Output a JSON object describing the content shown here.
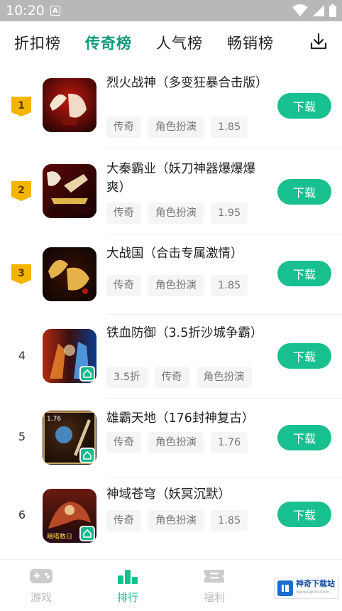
{
  "status_bar": {
    "time": "10:20",
    "a_icon": "A"
  },
  "tabs": [
    {
      "label": "折扣榜",
      "active": false
    },
    {
      "label": "传奇榜",
      "active": true
    },
    {
      "label": "人气榜",
      "active": false
    },
    {
      "label": "畅销榜",
      "active": false
    }
  ],
  "colors": {
    "accent": "#18c08f",
    "accent_dark": "#0e9b79",
    "badge_gold": "#f5b400"
  },
  "games": [
    {
      "rank": "1",
      "title": "烈火战神（多变狂暴合击版）",
      "tags": [
        "传奇",
        "角色扮演",
        "1.85"
      ],
      "button": "下载",
      "icon": "hehe-red-icon"
    },
    {
      "rank": "2",
      "title": "大秦霸业（妖刀神器爆爆爆爽）",
      "tags": [
        "传奇",
        "角色扮演",
        "1.95"
      ],
      "button": "下载",
      "icon": "shenjian-icon"
    },
    {
      "rank": "3",
      "title": "大战国（合击专属激情）",
      "tags": [
        "传奇",
        "角色扮演",
        "1.85"
      ],
      "button": "下载",
      "icon": "heji-gold-icon"
    },
    {
      "rank": "4",
      "title": "铁血防御（3.5折沙城争霸）",
      "tags": [
        "3.5折",
        "传奇",
        "角色扮演"
      ],
      "button": "下载",
      "icon": "warrior-fire-icon"
    },
    {
      "rank": "5",
      "title": "雄霸天地（176封神复古）",
      "tags": [
        "传奇",
        "角色扮演",
        "1.76"
      ],
      "button": "下载",
      "icon": "sword-orb-icon",
      "icon_text": "1.76"
    },
    {
      "rank": "6",
      "title": "神域苍穹（妖冥沉默）",
      "tags": [
        "传奇",
        "角色扮演",
        "1.85"
      ],
      "button": "下载",
      "icon": "dragon-rider-icon",
      "icon_text": "嘀嗒数日"
    }
  ],
  "bottom_nav": [
    {
      "label": "游戏",
      "icon": "gamepad-icon",
      "active": false
    },
    {
      "label": "排行",
      "icon": "bar-chart-icon",
      "active": true
    },
    {
      "label": "福利",
      "icon": "ticket-icon",
      "active": false
    }
  ],
  "watermark": {
    "text": "神奇下载站",
    "sub": "www.sqcro.com"
  }
}
